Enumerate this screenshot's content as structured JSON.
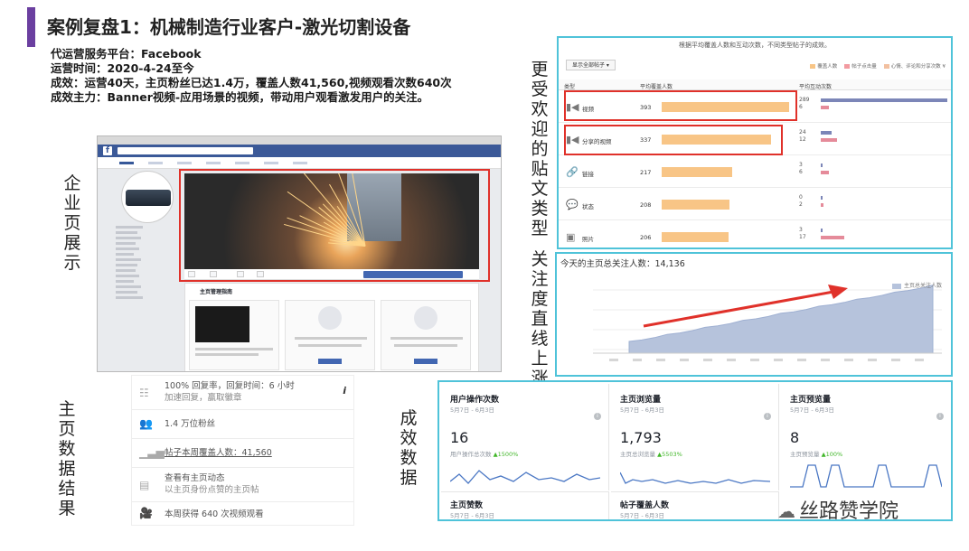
{
  "header": {
    "title": "案例复盘1：机械制造行业客户-激光切割设备",
    "lines": [
      "代运营服务平台：Facebook",
      "运营时间：2020-4-24至今",
      "成效：运营40天，主页粉丝已达1.4万，覆盖人数41,560,视频观看次数640次",
      "成效主力：Banner视频-应用场景的视频，带动用户观看激发用户的关注。"
    ]
  },
  "labels": {
    "enterprise_page": "企业页展示",
    "popular_posts": "更受欢迎的贴文类型",
    "follow_growth": "关注度直线上涨",
    "page_data_results": "主页数据结果",
    "results": "成效数据"
  },
  "post_types": {
    "caption": "根据平均覆盖人数和互动次数，不同类型帖子的成效。",
    "filter": "显示全部帖子 ▾",
    "legend": [
      "覆盖人数",
      "帖子点击量",
      "心情、评论和分享次数 ¥"
    ],
    "columns": [
      "类型",
      "平均覆盖人数",
      "平均互动次数"
    ],
    "rows": [
      {
        "icon": "video-icon",
        "label": "视频",
        "reach": 393,
        "a": 289,
        "b": 6
      },
      {
        "icon": "video-icon",
        "label": "分享的视频",
        "reach": 337,
        "a": 24,
        "b": 12
      },
      {
        "icon": "link-icon",
        "label": "链接",
        "reach": 217,
        "a": 3,
        "b": 6
      },
      {
        "icon": "status-icon",
        "label": "状态",
        "reach": 208,
        "a": 0,
        "b": 2
      },
      {
        "icon": "photo-icon",
        "label": "照片",
        "reach": 206,
        "a": 3,
        "b": 17
      }
    ]
  },
  "follow": {
    "title": "今天的主页总关注人数：14,136",
    "legend": "主页总关注人数"
  },
  "summary": {
    "response_line": "100% 回复率，回复时间：6 小时",
    "response_sub": "加速回复，赢取徽章",
    "fans": "1.4 万位粉丝",
    "reach": "帖子本周覆盖人数：41,560",
    "activity": "查看有主页动态",
    "activity_sub": "以主页身份点赞的主页帖",
    "video": "本周获得 640 次视频观看"
  },
  "cards": [
    {
      "title": "用户操作次数",
      "date": "5月7日 - 6月3日",
      "value": "16",
      "sub": "用户操作总次数",
      "change": "▲1500%"
    },
    {
      "title": "主页浏览量",
      "date": "5月7日 - 6月3日",
      "value": "1,793",
      "sub": "主页总浏览量",
      "change": "▲5503%"
    },
    {
      "title": "主页预览量",
      "date": "5月7日 - 6月3日",
      "value": "8",
      "sub": "主页预览量",
      "change": "▲100%"
    }
  ],
  "cards_bottom": [
    {
      "title": "主页赞数",
      "date": "5月7日 - 6月3日"
    },
    {
      "title": "帖子覆盖人数",
      "date": "5月7日 - 6月3日"
    }
  ],
  "facebook": {
    "guide_title": "主页管理指南"
  },
  "watermark": "丝路赞学院",
  "colors": {
    "accent_purple": "#6b3fa0",
    "highlight_red": "#e0312a",
    "panel_cyan": "#4fc3d9",
    "reach_orange": "#f8c586",
    "fb_blue": "#3b5998",
    "growth_green": "#42b72a"
  }
}
